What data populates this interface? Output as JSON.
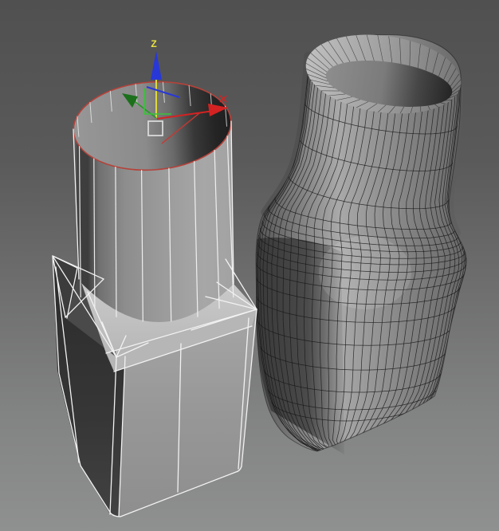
{
  "viewport": {
    "background_top": "#505050",
    "background_bottom": "#8f9090"
  },
  "gizmo": {
    "z_axis_label": "Z",
    "x_axis_color": "#d42222",
    "y_axis_color": "#259925",
    "z_axis_color": "#2838d8",
    "active_axis_color": "#ddd83e",
    "plane_handle_green": "#39c439",
    "center_box_color": "#d9d9d9"
  },
  "selection": {
    "ring_color": "#b5423a"
  },
  "objects": {
    "left_lowpoly": {
      "edge_color": "#f2f2f2"
    },
    "right_smoothed": {
      "edge_color": "#161616"
    }
  }
}
